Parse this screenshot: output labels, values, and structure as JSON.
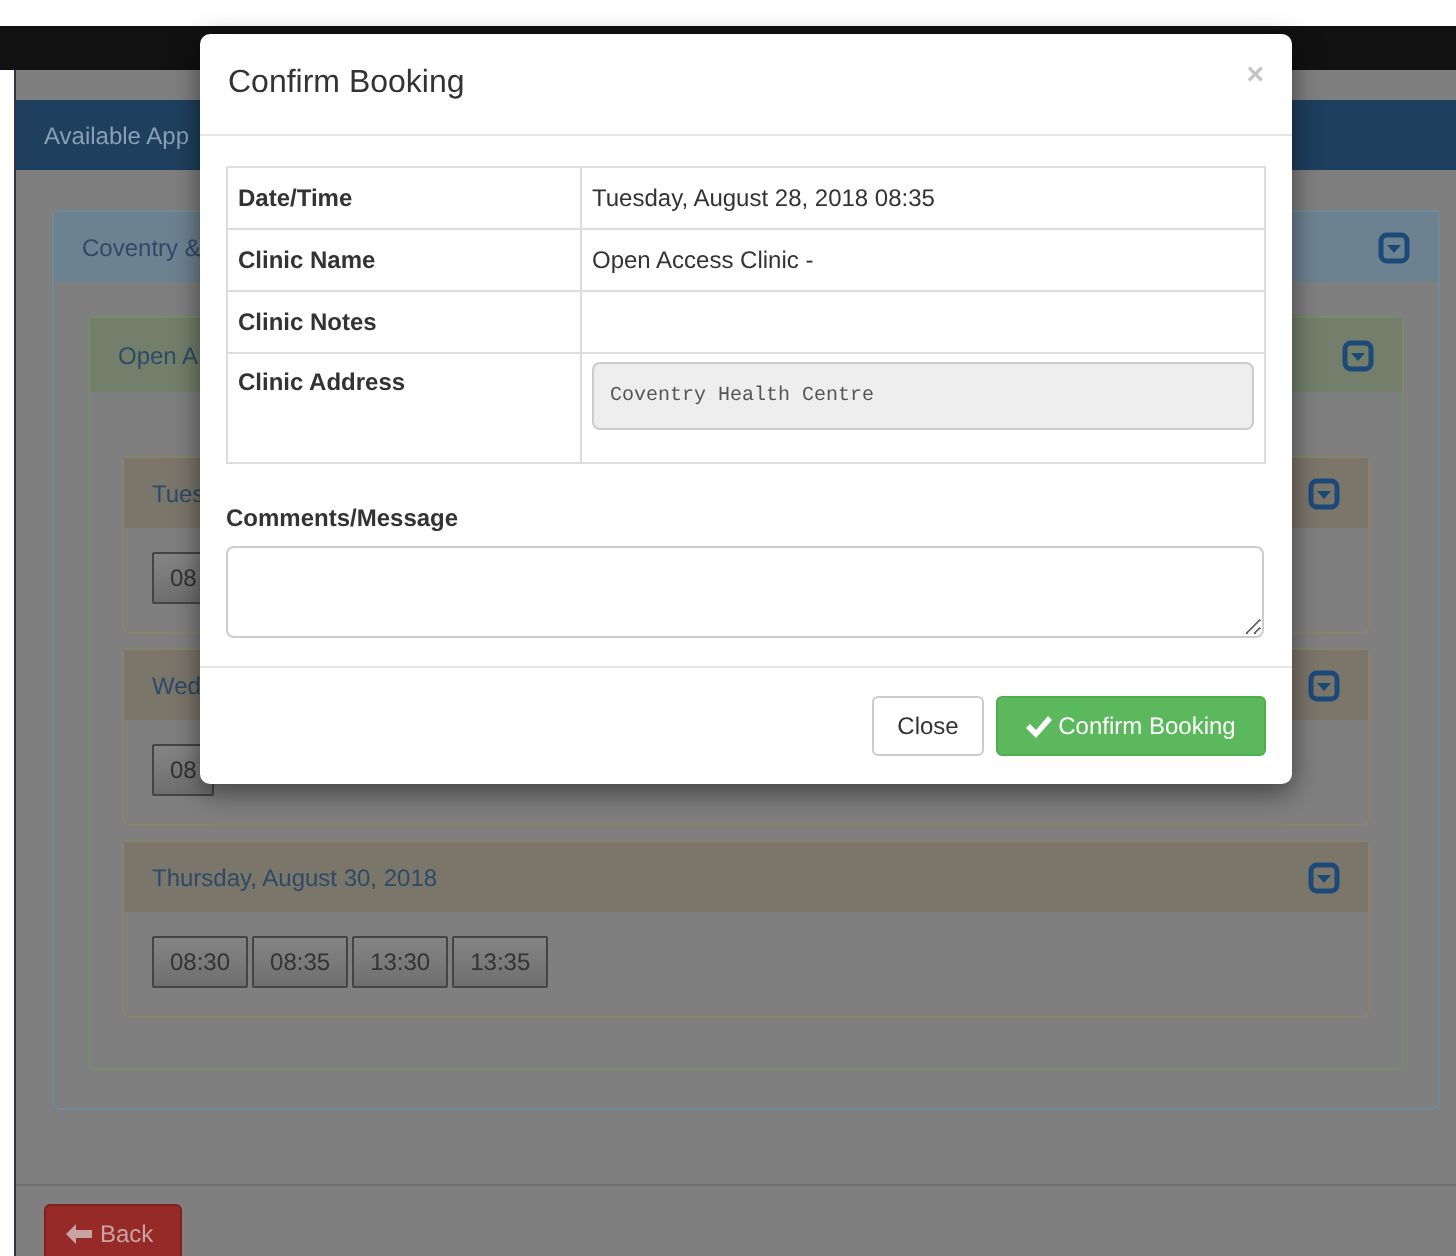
{
  "background": {
    "header_title": "Available App",
    "region": {
      "title": "Coventry &",
      "clinic": {
        "title": "Open A",
        "days": [
          {
            "title": "Tues",
            "times": [
              "08"
            ]
          },
          {
            "title": "Wed",
            "times": [
              "08"
            ]
          },
          {
            "title": "Thursday, August 30, 2018",
            "times": [
              "08:30",
              "08:35",
              "13:30",
              "13:35"
            ]
          }
        ]
      }
    },
    "back_button": {
      "label": "Back"
    }
  },
  "modal": {
    "title": "Confirm Booking",
    "close": "×",
    "rows": [
      {
        "label": "Date/Time",
        "value": "Tuesday, August 28, 2018 08:35",
        "kind": "text"
      },
      {
        "label": "Clinic Name",
        "value": "Open Access Clinic -",
        "kind": "text"
      },
      {
        "label": "Clinic Notes",
        "kind": "text"
      },
      {
        "label": "Clinic Address",
        "value": "Coventry Health Centre",
        "kind": "field"
      }
    ],
    "comments_label": "Comments/Message",
    "buttons": [
      {
        "label": "Close",
        "kind": "default"
      },
      {
        "label": "Confirm Booking",
        "kind": "success"
      }
    ]
  }
}
